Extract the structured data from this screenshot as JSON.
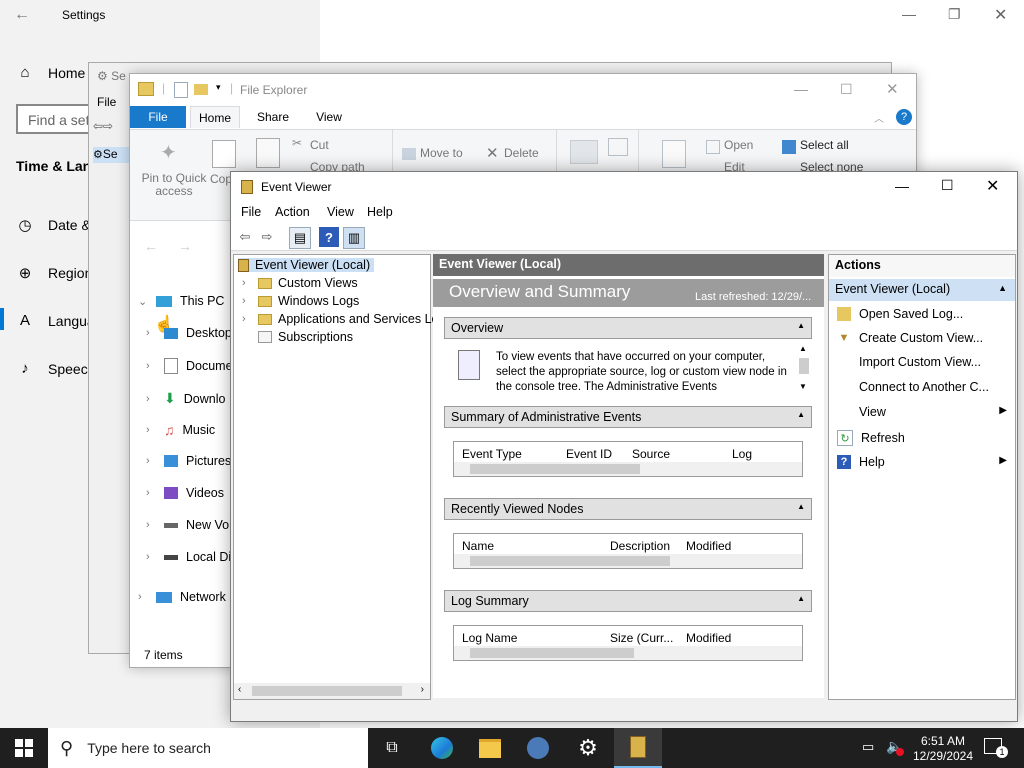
{
  "settings": {
    "title": "Settings",
    "home": "Home",
    "search_placeholder": "Find a set",
    "section": "Time & Lan",
    "items": [
      "Date &",
      "Region",
      "Langua",
      "Speech"
    ]
  },
  "bg_window": {
    "title": "Se",
    "menu": "File",
    "item": "Se"
  },
  "explorer": {
    "title": "File Explorer",
    "tabs": [
      "File",
      "Home",
      "Share",
      "View"
    ],
    "ribbon": {
      "pin": "Pin to Quick access",
      "copy": "Cop",
      "cut": "Cut",
      "copy_path": "Copy path",
      "move_to": "Move to",
      "delete": "Delete",
      "open": "Open",
      "edit": "Edit",
      "select_all": "Select all",
      "select_none": "Select none"
    },
    "tree": {
      "this_pc": "This PC",
      "items": [
        "Desktop",
        "Docume",
        "Downlo",
        "Music",
        "Pictures",
        "Videos",
        "New Vol",
        "Local Di"
      ],
      "network": "Network"
    },
    "status": "7 items"
  },
  "event_viewer": {
    "title": "Event Viewer",
    "menu": [
      "File",
      "Action",
      "View",
      "Help"
    ],
    "tree": [
      "Event Viewer (Local)",
      "Custom Views",
      "Windows Logs",
      "Applications and Services Lo",
      "Subscriptions"
    ],
    "center_header": "Event Viewer (Local)",
    "banner_title": "Overview and Summary",
    "last_refreshed": "Last refreshed: 12/29/...",
    "sections": {
      "overview": "Overview",
      "overview_text": "To view events that have occurred on your computer, select the appropriate source, log or custom view node in the console tree. The Administrative Events",
      "admin": "Summary of Administrative Events",
      "admin_cols": [
        "Event Type",
        "Event ID",
        "Source",
        "Log"
      ],
      "recent": "Recently Viewed Nodes",
      "recent_cols": [
        "Name",
        "Description",
        "Modified"
      ],
      "logsum": "Log Summary",
      "logsum_cols": [
        "Log Name",
        "Size (Curr...",
        "Modified"
      ]
    },
    "actions": {
      "header": "Actions",
      "group": "Event Viewer (Local)",
      "items": [
        "Open Saved Log...",
        "Create Custom View...",
        "Import Custom View...",
        "Connect to Another C...",
        "View",
        "Refresh",
        "Help"
      ]
    }
  },
  "taskbar": {
    "search_placeholder": "Type here to search",
    "time": "6:51 AM",
    "date": "12/29/2024",
    "notifications": "1"
  },
  "colors": {
    "accent": "#0078d4",
    "taskbar": "#1f1f1f"
  }
}
